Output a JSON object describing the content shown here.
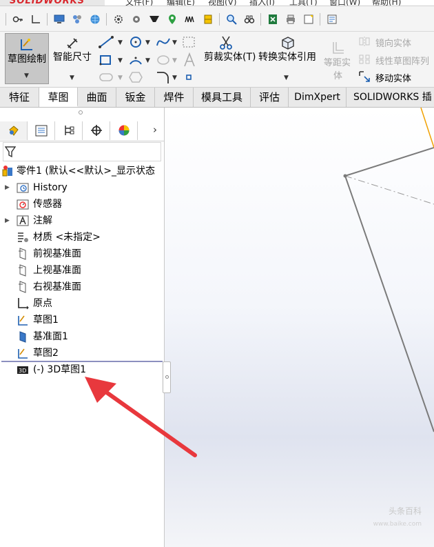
{
  "app": {
    "logo_text": "SOLIDWORKS"
  },
  "menu": {
    "items": [
      "文件(F)",
      "编辑(E)",
      "视图(V)",
      "插入(I)",
      "工具(T)",
      "窗口(W)",
      "帮助(H)"
    ]
  },
  "commands": {
    "sketch": "草图绘制",
    "smart_dim": "智能尺寸",
    "trim": "剪裁实体(T)",
    "convert": "转换实体引用",
    "offset_line1": "等距实",
    "offset_line2": "体",
    "mirror": "镜向实体",
    "linear_pattern": "线性草图阵列",
    "move": "移动实体"
  },
  "tabs": [
    {
      "label": "特征"
    },
    {
      "label": "草图"
    },
    {
      "label": "曲面"
    },
    {
      "label": "钣金"
    },
    {
      "label": "焊件"
    },
    {
      "label": "模具工具"
    },
    {
      "label": "评估"
    },
    {
      "label": "DimXpert"
    },
    {
      "label": "SOLIDWORKS 插件"
    }
  ],
  "tree": {
    "root": "零件1 (默认<<默认>_显示状态",
    "history": "History",
    "sensors": "传感器",
    "annotations": "注解",
    "material": "材质 <未指定>",
    "front_plane": "前视基准面",
    "top_plane": "上视基准面",
    "right_plane": "右视基准面",
    "origin": "原点",
    "sketch1": "草图1",
    "plane1": "基准面1",
    "sketch2": "草图2",
    "sketch3d": "(-) 3D草图1"
  },
  "watermark": {
    "brand": "头条百科",
    "url": "www.baike.com"
  },
  "colors": {
    "accent": "#d9262c",
    "arrow": "#e8383d",
    "active_tab": "#ffffff",
    "sketch_highlight": "#c7c7c7"
  }
}
